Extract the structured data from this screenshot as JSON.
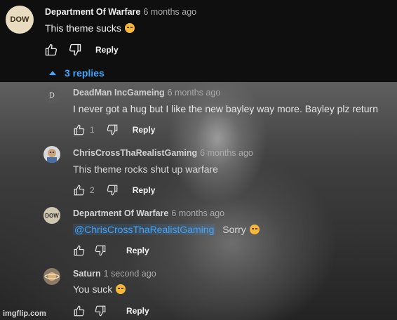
{
  "top_comment": {
    "author": "Department Of Warfare",
    "time": "6 months ago",
    "text": "This theme sucks",
    "reply_label": "Reply",
    "avatar_text": "DOW"
  },
  "replies_toggle": {
    "label": "3 replies"
  },
  "replies": [
    {
      "author": "DeadMan IncGameing",
      "time": "6 months ago",
      "text": "I never got a hug but I like the new bayley way more. Bayley plz return",
      "likes": "1",
      "reply_label": "Reply",
      "avatar_text": "D"
    },
    {
      "author": "ChrisCrossThaRealistGaming",
      "time": "6 months ago",
      "text": "This theme rocks shut up warfare",
      "likes": "2",
      "reply_label": "Reply"
    },
    {
      "author": "Department Of Warfare",
      "time": "6 months ago",
      "mention": "@ChrisCrossThaRealistGaming",
      "text": "Sorry",
      "likes": "",
      "reply_label": "Reply",
      "avatar_text": "DOW"
    },
    {
      "author": "Saturn",
      "time": "1 second ago",
      "text": "You suck",
      "likes": "",
      "reply_label": "Reply"
    }
  ],
  "watermark": "imgflip.com",
  "colors": {
    "link": "#3ea6ff",
    "background": "#0f0f0f",
    "meta": "#aaaaaa"
  }
}
